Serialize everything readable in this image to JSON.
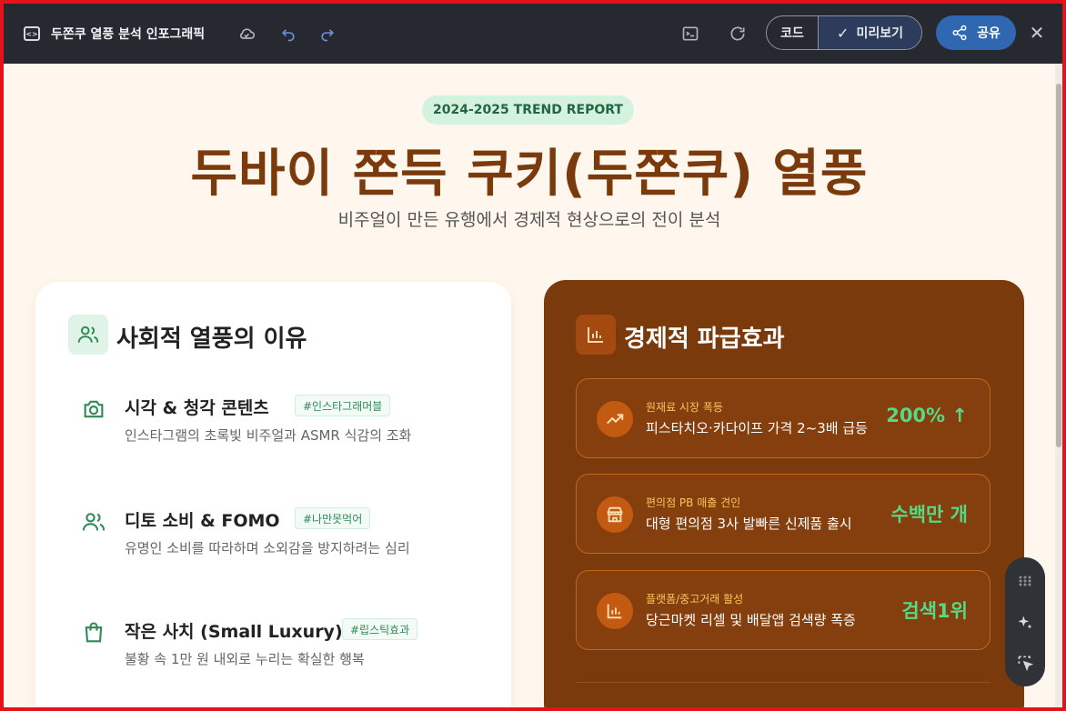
{
  "topbar": {
    "doc_icon": "code-document-icon",
    "title": "두쫀쿠 열풍 분석 인포그래픽",
    "icons": [
      "cloud-icon",
      "undo-icon",
      "redo-icon",
      "terminal-icon",
      "refresh-icon"
    ],
    "code_label": "코드",
    "preview_label": "미리보기",
    "share_label": "공유",
    "close_label": "✕"
  },
  "hero": {
    "badge": "2024-2025 TREND REPORT",
    "title": "두바이 쫀득 쿠키(두쫀쿠) 열풍",
    "subtitle": "비주얼이 만든 유행에서 경제적 현상으로의 전이 분석"
  },
  "social": {
    "title": "사회적 열풍의 이유",
    "items": [
      {
        "icon": "camera-icon",
        "title": "시각 & 청각 콘텐츠",
        "tag": "#인스타그래머블",
        "desc": "인스타그램의 초록빛 비주얼과 ASMR 식감의 조화"
      },
      {
        "icon": "users-icon",
        "title": "디토 소비 & FOMO",
        "tag": "#나만못먹어",
        "desc": "유명인 소비를 따라하며 소외감을 방지하려는 심리"
      },
      {
        "icon": "shopping-bag-icon",
        "title": "작은 사치 (Small Luxury)",
        "tag": "#립스틱효과",
        "desc": "불황 속 1만 원 내외로 누리는 확실한 행복"
      }
    ]
  },
  "economic": {
    "title": "경제적 파급효과",
    "items": [
      {
        "icon": "trending-up-icon",
        "label": "원재료 시장 폭등",
        "desc": "피스타치오·카다이프 가격 2~3배 급등",
        "value": "200% ↑"
      },
      {
        "icon": "store-icon",
        "label": "편의점 PB 매출 견인",
        "desc": "대형 편의점 3사 발빠른 신제품 출시",
        "value": "수백만 개"
      },
      {
        "icon": "bar-chart-icon",
        "label": "플랫폼/중고거래 활성",
        "desc": "당근마켓 리셀 및 배달앱 검색량 폭증",
        "value": "검색1위"
      }
    ]
  },
  "colors": {
    "brand_brown": "#7a3a0c",
    "accent_green": "#57d884",
    "badge_green": "#d3f2df",
    "frame_red": "#e4131b"
  }
}
